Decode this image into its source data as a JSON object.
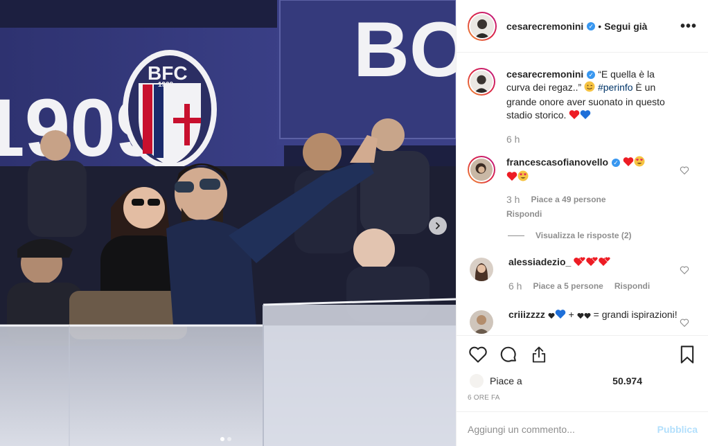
{
  "post": {
    "author": "cesarecremonini",
    "follow_sep": "•",
    "follow_label": "Segui già",
    "more_label": "•••"
  },
  "caption": {
    "author": "cesarecremonini",
    "text_before": "“E quella è la curva dei regaz..” ",
    "hashtag": "#perinfo",
    "text_after": " È un grande onore aver suonato in questo stadio storico.",
    "time": "6 h"
  },
  "comments": [
    {
      "author": "francescasofianovello",
      "text": "",
      "time": "3 h",
      "likes": "Piace a 49 persone",
      "reply": "Rispondi",
      "view_replies": "Visualizza le risposte (2)"
    },
    {
      "author": "alessiadezio_",
      "text": "",
      "time": "6 h",
      "likes": "Piace a 5 persone",
      "reply": "Rispondi"
    },
    {
      "author": "criiizzzz",
      "text_mid": " + ",
      "text_end": " = grandi ispirazioni!"
    }
  ],
  "photo_text": {
    "stand_left": "1909",
    "stand_right": "BO",
    "crest_top": "BFC",
    "crest_year": "1909"
  },
  "likes_row": {
    "label": "Piace a",
    "count": "50.974"
  },
  "date": "6 ORE FA",
  "add_comment": {
    "placeholder": "Aggiungi un commento...",
    "publish": "Pubblica"
  },
  "icons": {
    "like": "heart-icon",
    "comment": "comment-icon",
    "share": "share-icon",
    "save": "bookmark-icon",
    "next": "chevron-right-icon",
    "verified": "verified-badge-icon"
  },
  "colors": {
    "heart_red": "#ed1c24",
    "heart_blue": "#1e6fd9",
    "verified": "#3897f0",
    "hashtag": "#003569",
    "publish_disabled": "#b2dffc"
  },
  "carousel": {
    "current": 1,
    "total": 2
  }
}
